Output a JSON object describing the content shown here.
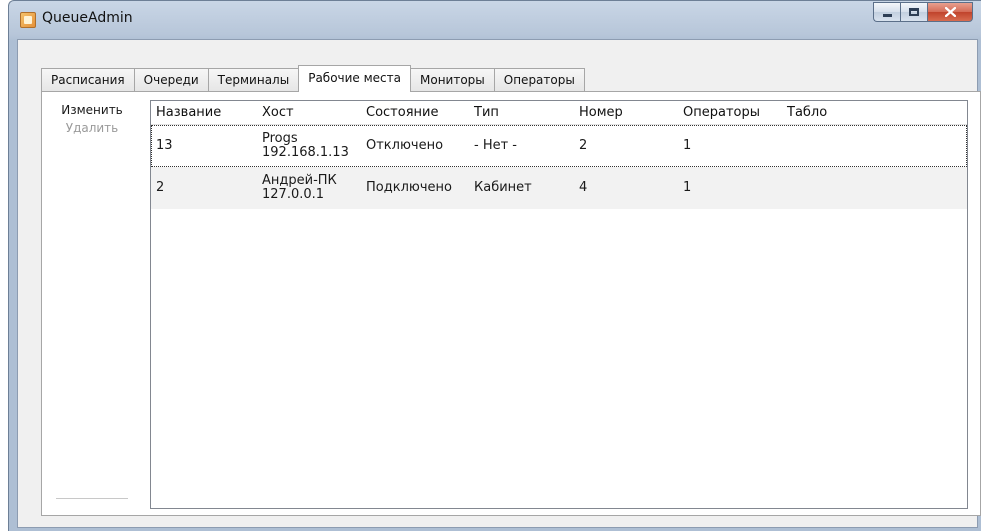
{
  "window": {
    "title": "QueueAdmin"
  },
  "tabs": [
    {
      "label": "Расписания",
      "active": false
    },
    {
      "label": "Очереди",
      "active": false
    },
    {
      "label": "Терминалы",
      "active": false
    },
    {
      "label": "Рабочие места",
      "active": true
    },
    {
      "label": "Мониторы",
      "active": false
    },
    {
      "label": "Операторы",
      "active": false
    }
  ],
  "actions": {
    "edit_label": "Изменить",
    "delete_label": "Удалить"
  },
  "grid": {
    "columns": [
      "Название",
      "Хост",
      "Состояние",
      "Тип",
      "Номер",
      "Операторы",
      "Табло"
    ],
    "rows": [
      {
        "name": "13",
        "host_name": "Progs",
        "host_ip": "192.168.1.13",
        "state": "Отключено",
        "type": "- Нет -",
        "number": "2",
        "operators": "1",
        "board": "",
        "selected": true
      },
      {
        "name": "2",
        "host_name": "Андрей-ПК",
        "host_ip": "127.0.0.1",
        "state": "Подключено",
        "type": "Кабинет",
        "number": "4",
        "operators": "1",
        "board": "",
        "selected": false
      }
    ]
  },
  "icons": {
    "app": "app-icon",
    "minimize": "minimize-icon",
    "maximize": "maximize-icon",
    "close": "close-icon"
  },
  "colors": {
    "close_button": "#c0432c",
    "titlebar": "#b7c6d9",
    "selection_outline": "#333333"
  }
}
